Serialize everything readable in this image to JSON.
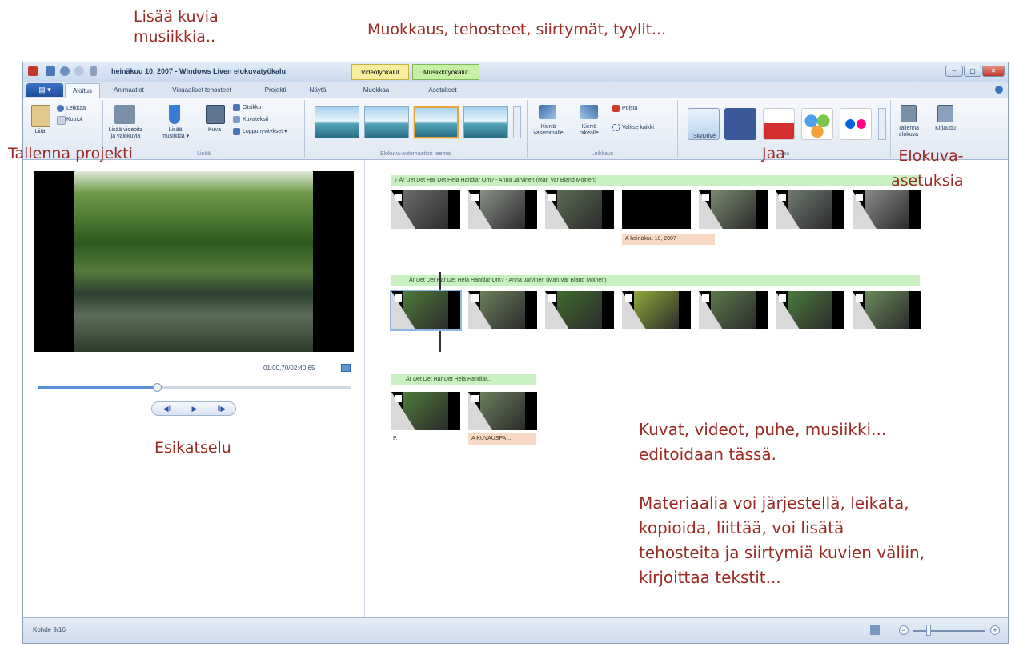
{
  "annotations": {
    "add_media": "Lisää kuvia\nmusiikkia..",
    "editing": "Muokkaus, tehosteet, siirtymät, tyylit...",
    "save_project": "Tallenna projekti",
    "share": "Jaa",
    "movie_settings": "Elokuva-\nasetuksia",
    "preview": "Esikatselu",
    "storyboard_info": "Kuvat, videot, puhe, musiikki...\neditoidaan tässä.",
    "storyboard_info2": "Materiaalia voi järjestellä, leikata,\nkopioida, liittää, voi lisätä\ntehosteita ja siirtymiä kuvien väliin,\nkirjoittaa tekstit..."
  },
  "window": {
    "title": "heinäkuu 10, 2007 - Windows Liven elokuvatyökalu",
    "context_tabs": [
      "Videotyökalut",
      "Musiikkityökalut"
    ],
    "controls": [
      "–",
      "▢",
      "✕"
    ]
  },
  "tabs": {
    "file": "▤ ▾",
    "items": [
      "Aloitus",
      "Animaatiot",
      "Visuaaliset tehosteet",
      "Projekti",
      "Näytä",
      "Muokkaa",
      "Asetukset"
    ]
  },
  "ribbon": {
    "clipboard": {
      "paste": "Liitä",
      "cut": "Leikkaa",
      "copy": "Kopioi"
    },
    "add": {
      "add_videos": "Lisää videoita\nja valokuvia",
      "add_music": "Lisää\nmusiikkia ▾",
      "snapshot": "Kuva",
      "title": "Otsikko",
      "caption": "Kuvateksti",
      "credits": "Loppuhyvitykset ▾",
      "label": "Lisää"
    },
    "themes_label": "Elokuva-automaation teemat",
    "editing": {
      "rotate_left": "Kierrä\nvasemmalle",
      "rotate_right": "Kierrä\noikealle",
      "delete": "Poista",
      "select_all": "Valitse kaikki",
      "label": "Leikkaus"
    },
    "share": {
      "skydrive": "SkyDrive",
      "label": "Jaa"
    },
    "save_movie": "Tallenna\nelokuva",
    "signin": "Kirjaudu"
  },
  "preview": {
    "timecode": "01:00,70/02:40,65",
    "progress": 0.38,
    "buttons": [
      "◀‖",
      "▶",
      "‖▶"
    ]
  },
  "storyboard": {
    "row1_music": "♪ Är Det Det Här Det Hela Handlar Om? - Anna Jarvinen (Man Var Bland Molnen)",
    "row1_caption": "A heinäkuu 10, 2007",
    "row2_music": "Är Det Det Här Det Hela Handlar Om? - Anna Jarvinen (Man Var Bland Molnen)",
    "row3_music": "Är Det Det Här Det Hela Handlar...",
    "row3_caption1": "P.",
    "row3_caption2": "A KUVAUSPA..."
  },
  "status": {
    "text": "Kohde 9/16",
    "zoom_minus": "−",
    "zoom_plus": "+"
  },
  "colors": {
    "annotation": "#9b2a25",
    "music_bar": "#c9f0c0",
    "caption_bar": "#f8d9c5"
  }
}
